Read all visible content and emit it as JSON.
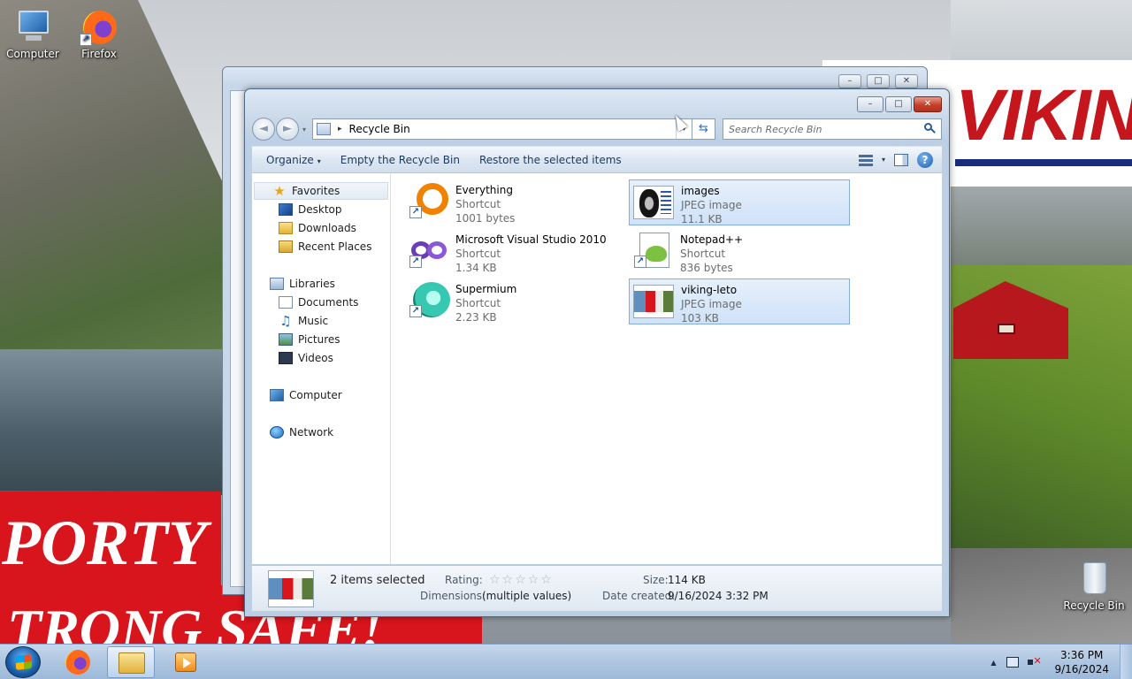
{
  "desktop": {
    "icons": [
      {
        "label": "Computer",
        "icon": "computer-icon"
      },
      {
        "label": "Firefox",
        "icon": "firefox-icon"
      },
      {
        "label": "Recycle Bin",
        "icon": "recycle-bin-icon"
      }
    ],
    "wallpaper": {
      "banner_text": "VIKING",
      "red_text_1": "PORTY",
      "red_text_2": "TRONG  SAFE!"
    }
  },
  "window": {
    "caption": {
      "minimize": "–",
      "maximize": "□",
      "close": "✕"
    },
    "nav": {
      "back": "◄",
      "forward": "►",
      "dropdown": "▾"
    },
    "address": {
      "separator": "▸",
      "path": "Recycle Bin",
      "dropdown": "▾",
      "refresh": "⇆"
    },
    "search": {
      "placeholder": "Search Recycle Bin"
    },
    "toolbar": {
      "organize": "Organize",
      "organize_caret": "▾",
      "empty": "Empty the Recycle Bin",
      "restore": "Restore the selected items",
      "views_caret": "▾",
      "help": "?"
    },
    "nav_pane": {
      "favorites": "Favorites",
      "desktop": "Desktop",
      "downloads": "Downloads",
      "recent": "Recent Places",
      "libraries": "Libraries",
      "documents": "Documents",
      "music": "Music",
      "pictures": "Pictures",
      "videos": "Videos",
      "computer": "Computer",
      "network": "Network"
    },
    "files": [
      {
        "name": "Everything",
        "type": "Shortcut",
        "size": "1001 bytes",
        "icon": "everything-icon",
        "selected": false
      },
      {
        "name": "images",
        "type": "JPEG image",
        "size": "11.1 KB",
        "icon": "image-thumbnail",
        "selected": true
      },
      {
        "name": "Microsoft Visual Studio 2010",
        "type": "Shortcut",
        "size": "1.34 KB",
        "icon": "visual-studio-icon",
        "selected": false
      },
      {
        "name": "Notepad++",
        "type": "Shortcut",
        "size": "836 bytes",
        "icon": "notepad-plus-plus-icon",
        "selected": false
      },
      {
        "name": "Supermium",
        "type": "Shortcut",
        "size": "2.23 KB",
        "icon": "supermium-icon",
        "selected": false
      },
      {
        "name": "viking-leto",
        "type": "JPEG image",
        "size": "103 KB",
        "icon": "image-thumbnail",
        "selected": true
      }
    ],
    "details": {
      "selected": "2 items selected",
      "rating_label": "Rating:",
      "stars": "☆☆☆☆☆",
      "dimensions_label": "Dimensions:",
      "dimensions_value": "(multiple values)",
      "size_label": "Size:",
      "size_value": "114 KB",
      "created_label": "Date created:",
      "created_value": "9/16/2024 3:32 PM"
    }
  },
  "taskbar": {
    "tray_arrow": "▲",
    "time": "3:36 PM",
    "date": "9/16/2024"
  }
}
